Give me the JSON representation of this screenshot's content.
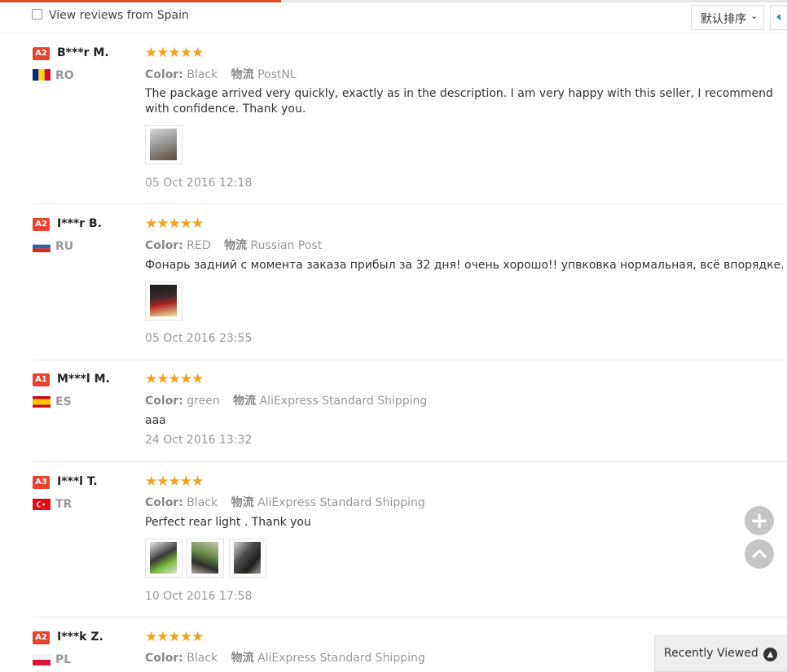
{
  "filter": {
    "checkbox_label": "View reviews from Spain",
    "sort_label": "默认排序",
    "sort_icon": "chevron-down-icon",
    "pager_icon": "chevron-left-icon"
  },
  "colors": {
    "accent": "#e64d25",
    "level_badge": "#e8432e",
    "star": "#f5a11f",
    "muted_text": "#999999"
  },
  "reviews": [
    {
      "level": "A2",
      "name": "B***r M.",
      "country": "RO",
      "rating_stars": 5,
      "stars": "★★★★★",
      "color_label": "Color:",
      "color_value": "Black",
      "shipping_label": "物流",
      "shipping_value": "PostNL",
      "text": "The package arrived very quickly, exactly as in the description. I am very happy with this seller, I recommend with confidence. Thank you.",
      "date": "05 Oct 2016 12:18",
      "photo_count": 1
    },
    {
      "level": "A2",
      "name": "I***r B.",
      "country": "RU",
      "rating_stars": 5,
      "stars": "★★★★★",
      "color_label": "Color:",
      "color_value": "RED",
      "shipping_label": "物流",
      "shipping_value": "Russian Post",
      "text": "Фонарь задний с момента заказа прибыл за 32 дня! очень хорошо!! упвковка нормальная, всё впорядке. рекомен",
      "date": "05 Oct 2016 23:55",
      "photo_count": 1
    },
    {
      "level": "A1",
      "name": "M***l M.",
      "country": "ES",
      "rating_stars": 5,
      "stars": "★★★★★",
      "color_label": "Color:",
      "color_value": "green",
      "shipping_label": "物流",
      "shipping_value": "AliExpress Standard Shipping",
      "text": "aaa",
      "date": "24 Oct 2016 13:32",
      "photo_count": 0
    },
    {
      "level": "A3",
      "name": "I***l T.",
      "country": "TR",
      "rating_stars": 5,
      "stars": "★★★★★",
      "color_label": "Color:",
      "color_value": "Black",
      "shipping_label": "物流",
      "shipping_value": "AliExpress Standard Shipping",
      "text": "Perfect rear light . Thank you",
      "date": "10 Oct 2016 17:58",
      "photo_count": 3
    },
    {
      "level": "A2",
      "name": "I***k Z.",
      "country": "PL",
      "rating_stars": 5,
      "stars": "★★★★★",
      "color_label": "Color:",
      "color_value": "Black",
      "shipping_label": "物流",
      "shipping_value": "AliExpress Standard Shipping"
    }
  ],
  "floating": {
    "add_icon": "plus-circle-icon",
    "top_icon": "chevron-up-circle-icon"
  },
  "recently_viewed": {
    "label": "Recently Viewed",
    "icon": "chevron-up-icon"
  }
}
